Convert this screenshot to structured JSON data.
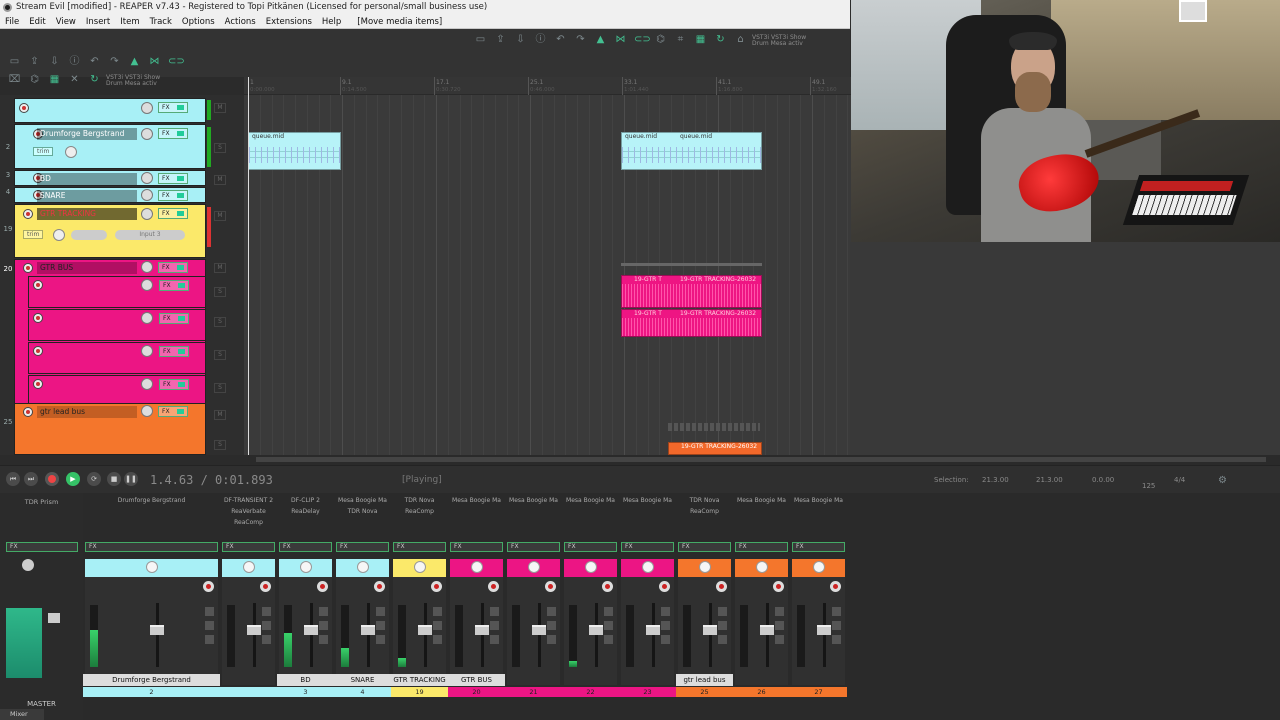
{
  "window": {
    "title": "Stream Evil [modified] - REAPER v7.43 - Registered to Topi Pitkänen (Licensed for personal/small business use)"
  },
  "menu": [
    "File",
    "Edit",
    "View",
    "Insert",
    "Item",
    "Track",
    "Options",
    "Actions",
    "Extensions",
    "Help",
    "[Move media items]"
  ],
  "toolbar": {
    "vst_label_1": "VST3i  VST3i  Show",
    "vst_label_2": "Drum  Mesa  activ"
  },
  "tracks": [
    {
      "num": "",
      "name": "",
      "color": "#a8f0f6"
    },
    {
      "num": "2",
      "name": "Drumforge Bergstrand",
      "color": "#a8f0f6",
      "trim": "trim"
    },
    {
      "num": "3",
      "name": "BD",
      "color": "#a8f0f6"
    },
    {
      "num": "4",
      "name": "SNARE",
      "color": "#a8f0f6"
    },
    {
      "num": "19",
      "name": "GTR TRACKING",
      "color": "#fbe96a",
      "trim": "trim",
      "input": "Input 3"
    },
    {
      "num": "20",
      "name": "GTR BUS",
      "color": "#ec1584"
    },
    {
      "num": "",
      "name": "",
      "color": "#ec1584"
    },
    {
      "num": "",
      "name": "",
      "color": "#ec1584"
    },
    {
      "num": "",
      "name": "",
      "color": "#ec1584"
    },
    {
      "num": "",
      "name": "",
      "color": "#ec1584"
    },
    {
      "num": "25",
      "name": "gtr lead bus",
      "color": "#f4762c"
    }
  ],
  "ruler": {
    "marks": [
      "1",
      "9.1",
      "17.1",
      "25.1",
      "33.1",
      "41.1",
      "49.1"
    ],
    "subs": [
      "0:00.000",
      "0:14.500",
      "0:30.720",
      "0:46.000",
      "1:01.440",
      "1:16.800",
      "1:32.160"
    ]
  },
  "items": {
    "midi_a": "queue.mid",
    "midi_b1": "queue.mid",
    "midi_b2": "queue.mid",
    "audio_1a": "19-GTR T",
    "audio_1b": "19-GTR TRACKING-26032",
    "audio_2a": "19-GTR T",
    "audio_2b": "19-GTR TRACKING-26032",
    "audio_3": "19-GTR TRACKING-26032"
  },
  "transport": {
    "time": "1.4.63 / 0:01.893",
    "state": "[Playing]",
    "selection_label": "Selection:",
    "sel_start": "21.3.00",
    "sel_end": "21.3.00",
    "sel_len": "0.0.00",
    "bpm": "125",
    "sig": "4/4"
  },
  "mixer": {
    "master_label": "MASTER",
    "master_fx": "TDR Prism",
    "tab": "Mixer",
    "strips": [
      {
        "fx": [
          "Drumforge Bergstrand",
          "",
          ""
        ],
        "name": "Drumforge Bergstrand",
        "num": "2",
        "color": "#a8f0f6",
        "wide": true
      },
      {
        "fx": [
          "DF-TRANSIENT 2",
          "ReaVerbate",
          "ReaComp"
        ],
        "name": "",
        "num": "",
        "color": "#a8f0f6"
      },
      {
        "fx": [
          "DF-CLIP 2",
          "ReaDelay",
          ""
        ],
        "name": "BD",
        "num": "3",
        "color": "#a8f0f6"
      },
      {
        "fx": [
          "Mesa Boogie Ma",
          "TDR Nova",
          ""
        ],
        "name": "SNARE",
        "num": "4",
        "color": "#a8f0f6"
      },
      {
        "fx": [
          "TDR Nova",
          "ReaComp",
          ""
        ],
        "name": "GTR TRACKING",
        "num": "19",
        "color": "#fbe96a"
      },
      {
        "fx": [
          "Mesa Boogie Ma",
          "",
          ""
        ],
        "name": "GTR BUS",
        "num": "20",
        "color": "#ec1584"
      },
      {
        "fx": [
          "Mesa Boogie Ma",
          "",
          ""
        ],
        "name": "",
        "num": "21",
        "color": "#ec1584"
      },
      {
        "fx": [
          "Mesa Boogie Ma",
          "",
          ""
        ],
        "name": "",
        "num": "22",
        "color": "#ec1584"
      },
      {
        "fx": [
          "Mesa Boogie Ma",
          "",
          ""
        ],
        "name": "",
        "num": "23",
        "color": "#ec1584"
      },
      {
        "fx": [
          "TDR Nova",
          "ReaComp",
          ""
        ],
        "name": "gtr lead bus",
        "num": "25",
        "color": "#f4762c"
      },
      {
        "fx": [
          "Mesa Boogie Ma",
          "",
          ""
        ],
        "name": "",
        "num": "26",
        "color": "#f4762c"
      },
      {
        "fx": [
          "Mesa Boogie Ma",
          "",
          ""
        ],
        "name": "",
        "num": "27",
        "color": "#f4762c"
      }
    ]
  }
}
